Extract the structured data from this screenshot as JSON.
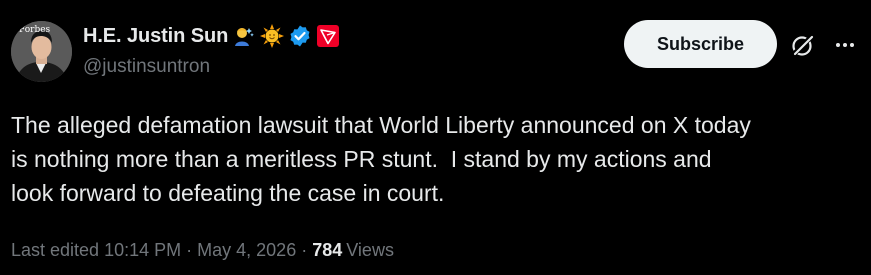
{
  "author": {
    "display_name": "H.E. Justin Sun",
    "handle": "@justinsuntron",
    "avatar_brand_text": "Forbes",
    "badges": [
      "person-emoji-icon",
      "sun-emoji-icon",
      "verified-badge-icon",
      "tron-logo-icon"
    ],
    "verified_color": "#1d9bf0",
    "tron_color": "#ef0027"
  },
  "actions": {
    "subscribe_label": "Subscribe",
    "grok_icon": "grok-icon",
    "more_icon": "more-horizontal-icon"
  },
  "tweet": {
    "text": "The alleged defamation lawsuit that World Liberty announced on X today\nis nothing more than a meritless PR stunt.  I stand by my actions and\nlook forward to defeating the case in court."
  },
  "meta": {
    "edited_label": "Last edited",
    "time": "10:14 PM",
    "separator": "·",
    "date": "May 4, 2026",
    "views_count": "784",
    "views_label": "Views"
  },
  "colors": {
    "background": "#000000",
    "primary_text": "#e7e9ea",
    "secondary_text": "#71767b",
    "button_bg": "#eff3f4",
    "button_text": "#0f1419"
  }
}
